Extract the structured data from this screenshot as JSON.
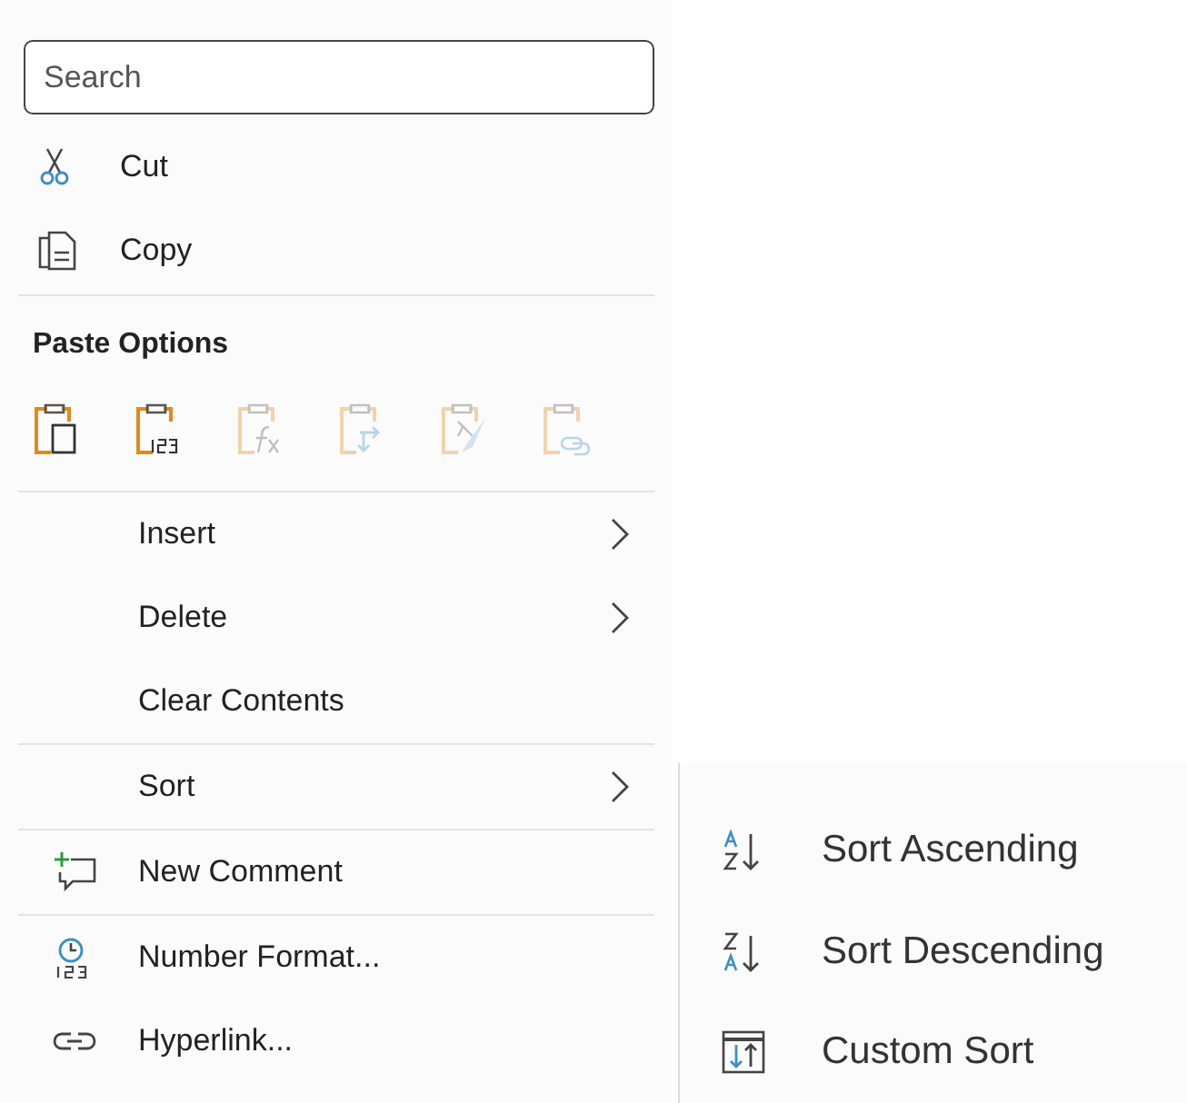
{
  "search": {
    "placeholder": "Search"
  },
  "top_items": [
    {
      "kind": "cut",
      "label": "Cut"
    },
    {
      "kind": "copy",
      "label": "Copy"
    }
  ],
  "paste_options": {
    "title": "Paste Options",
    "buttons": [
      {
        "kind": "paste",
        "disabled": false
      },
      {
        "kind": "values",
        "disabled": false
      },
      {
        "kind": "formulas",
        "disabled": true
      },
      {
        "kind": "transpose",
        "disabled": true
      },
      {
        "kind": "formatting",
        "disabled": true
      },
      {
        "kind": "link",
        "disabled": true
      }
    ]
  },
  "groups": [
    [
      {
        "label": "Insert",
        "submenu": true
      },
      {
        "label": "Delete",
        "submenu": true
      },
      {
        "label": "Clear Contents",
        "submenu": false
      }
    ],
    [
      {
        "label": "Sort",
        "submenu": true
      }
    ],
    [
      {
        "kind": "comment",
        "label": "New Comment"
      }
    ],
    [
      {
        "kind": "number",
        "label": "Number Format..."
      },
      {
        "kind": "link",
        "label": "Hyperlink..."
      }
    ]
  ],
  "sort_submenu": [
    {
      "kind": "ascending",
      "label": "Sort Ascending"
    },
    {
      "kind": "descending",
      "label": "Sort Descending"
    },
    {
      "kind": "custom",
      "label": "Custom Sort"
    }
  ]
}
